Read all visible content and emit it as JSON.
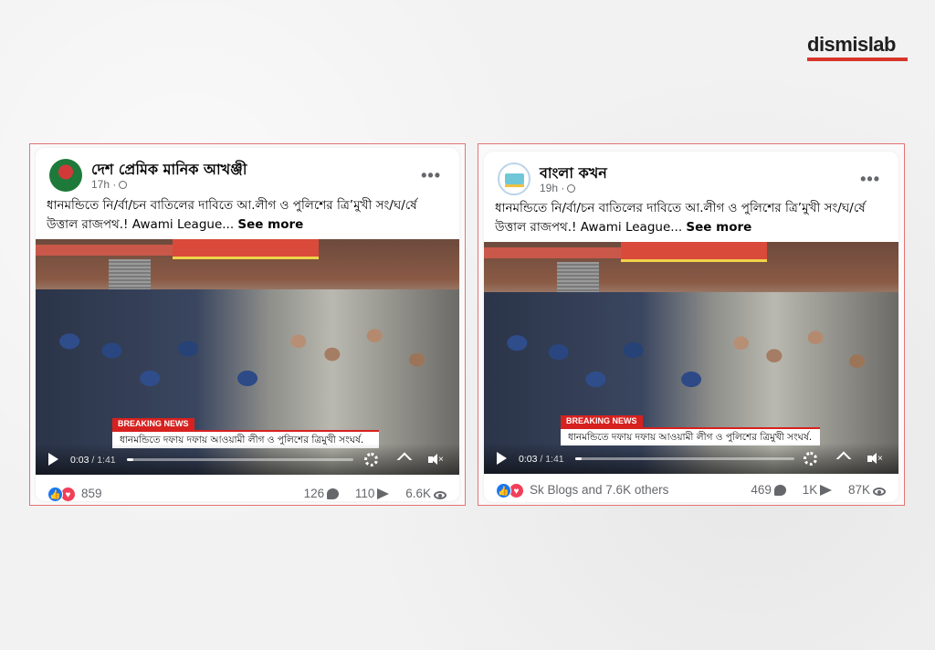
{
  "brand": {
    "logo": "dismislab",
    "accent": "#d9362b"
  },
  "posts": [
    {
      "author": "দেশ প্রেমিক মানিক আখঞ্জী",
      "time": "17h ·",
      "text": "ধানমন্ডিতে নি/র্বা/চন বাতিলের দাবিতে আ.লীগ ও পুলিশের ত্রি’মুখী সং/ঘ/র্ষে উত্তাল রাজপথ.! Awami League...",
      "see_more": "See more",
      "video": {
        "breaking": "BREAKING NEWS",
        "ticker": "ধানমন্ডিতে দফায় দফায় আওয়ামী লীগ ও পুলিশের ত্রিমুখী সংঘর্ষ.",
        "current_time": "0:03",
        "total_time": "/ 1:41",
        "progress_fraction": 0.03
      },
      "reactions_count": "859",
      "comments": "126",
      "shares": "110",
      "views": "6.6K"
    },
    {
      "author": "বাংলা কখন",
      "time": "19h ·",
      "text": "ধানমন্ডিতে নি/র্বা/চন বাতিলের দাবিতে আ.লীগ ও পুলিশের ত্রি’মুখী সং/ঘ/র্ষে উত্তাল রাজপথ.! Awami League...",
      "see_more": "See more",
      "video": {
        "breaking": "BREAKING NEWS",
        "ticker": "ধানমন্ডিতে দফায় দফায় আওয়ামী লীগ ও পুলিশের ত্রিমুখী সংঘর্ষ.",
        "current_time": "0:03",
        "total_time": "/ 1:41",
        "progress_fraction": 0.03
      },
      "reactions_count": "Sk Blogs and 7.6K others",
      "comments": "469",
      "shares": "1K",
      "views": "87K"
    }
  ]
}
